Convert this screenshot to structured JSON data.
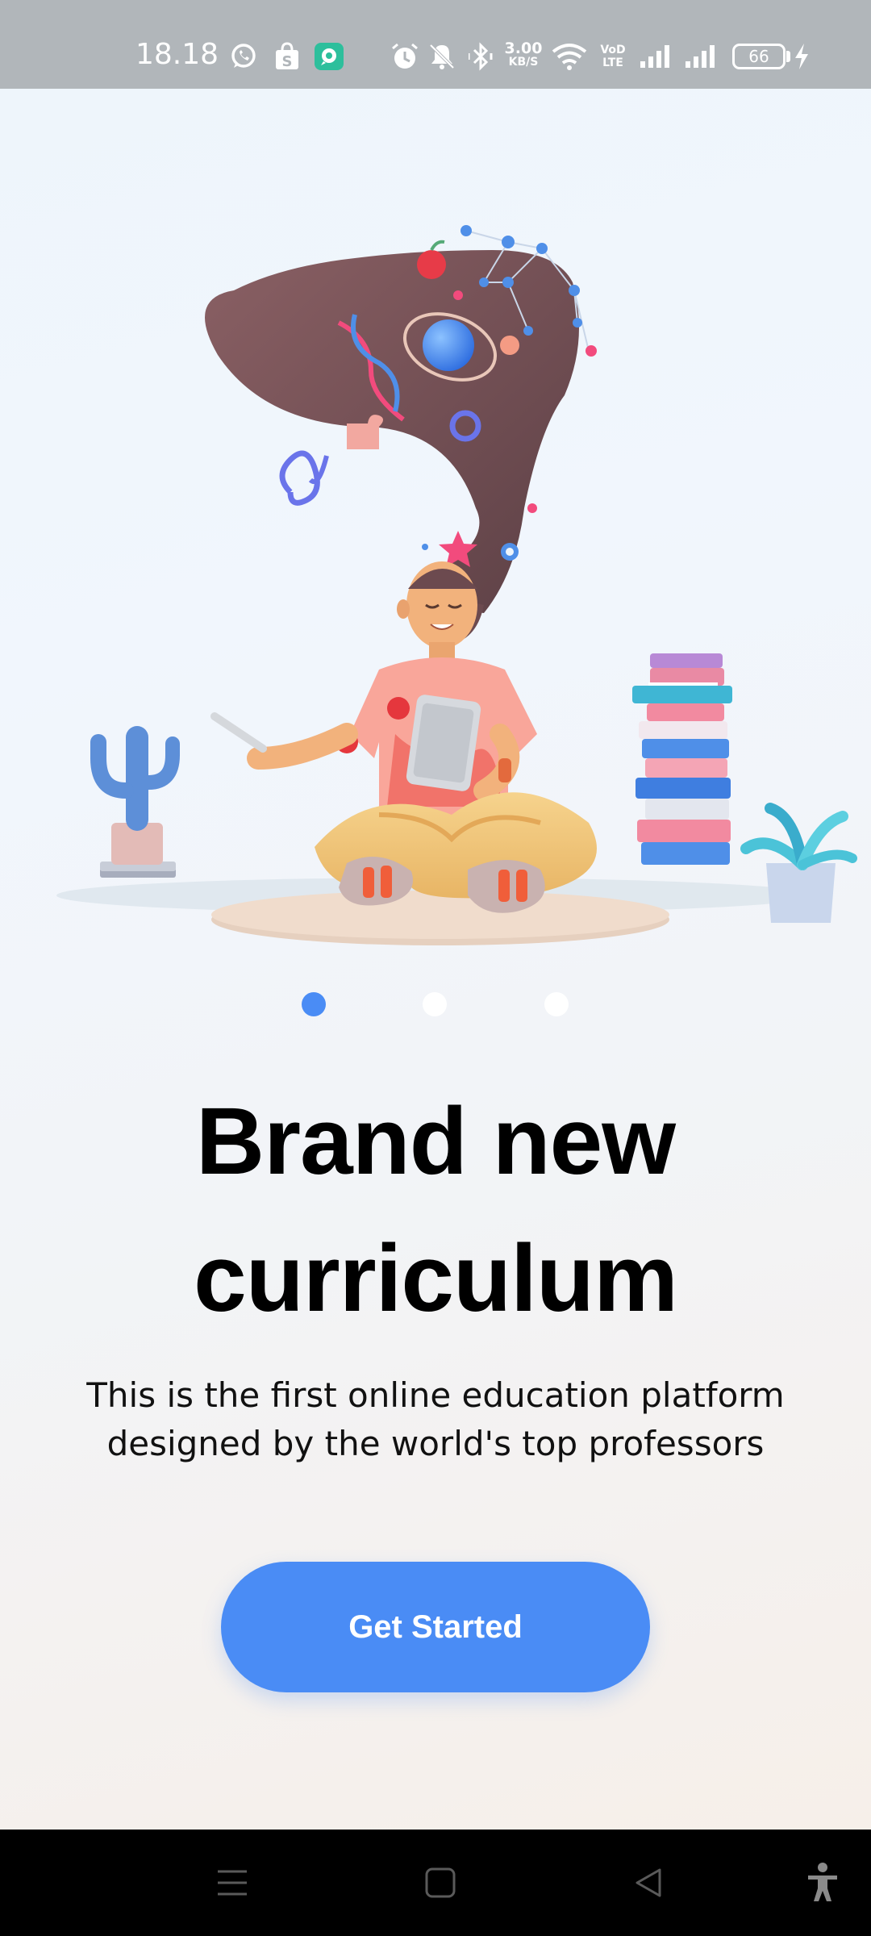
{
  "status_bar": {
    "time": "18.18",
    "net_speed_value": "3.00",
    "net_speed_unit": "KB/S",
    "volte_line1": "VoD",
    "volte_line2": "LTE",
    "battery_level": "66",
    "icons": [
      "whatsapp-icon",
      "shopping-bag-icon",
      "chat-app-icon",
      "alarm-icon",
      "mute-icon",
      "bluetooth-icon",
      "wifi-icon",
      "signal-icon",
      "battery-icon",
      "charging-icon"
    ]
  },
  "onboarding": {
    "pager": {
      "total": 3,
      "active_index": 0
    },
    "headline_line1": "Brand new",
    "headline_line2": "curriculum",
    "subtitle_line1": "This is the first online education platform",
    "subtitle_line2": "designed by the world's top professors",
    "cta_label": "Get Started"
  },
  "nav_bar": {
    "icons": [
      "menu-icon",
      "home-square-icon",
      "back-triangle-icon",
      "accessibility-icon"
    ]
  },
  "colors": {
    "accent": "#4a8cf5",
    "status_bar": "#b1b6ba",
    "nav_bar": "#000000",
    "headline": "#000000"
  }
}
